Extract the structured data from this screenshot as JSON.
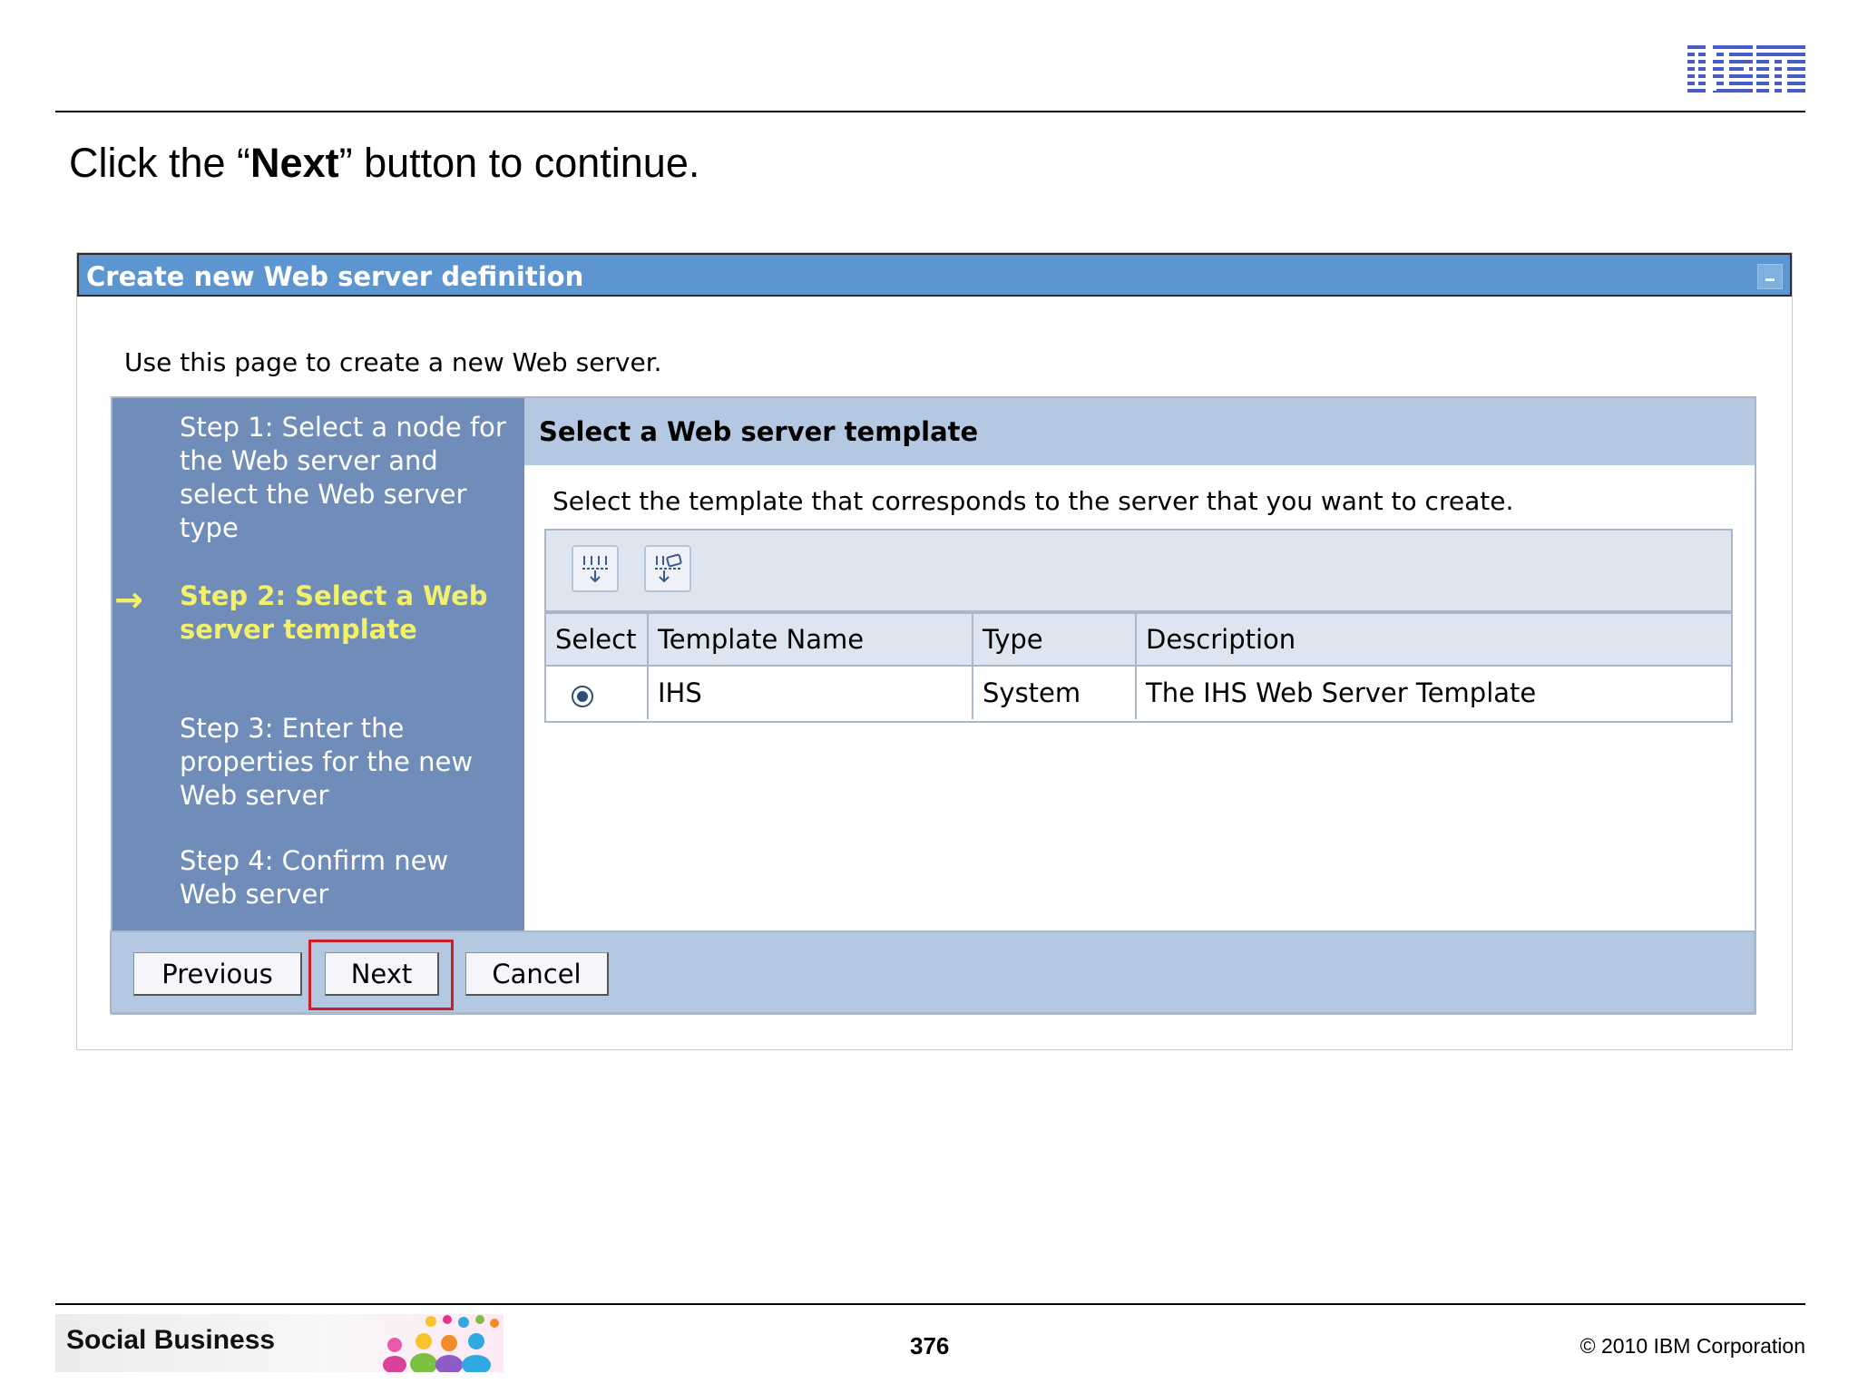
{
  "slide": {
    "logo_text": "IBM",
    "title_prefix": "Click the “",
    "title_emphasis": "Next",
    "title_suffix": "” button to continue.",
    "footer": {
      "brand": "Social Business",
      "page_number": "376",
      "copyright": "© 2010 IBM Corporation"
    }
  },
  "portlet": {
    "title": "Create new Web server definition",
    "intro": "Use this page to create a new Web server."
  },
  "wizard": {
    "current_step_index": 1,
    "steps": [
      "Step 1: Select a node for the Web server and select the Web server type",
      "Step 2: Select a Web server template",
      "Step 3: Enter the properties for the new Web server",
      "Step 4: Confirm new Web server"
    ],
    "section_title": "Select a Web server template",
    "section_description": "Select the template that corresponds to the server that you want to create.",
    "toolbar_icons": [
      "select-all-icon",
      "deselect-all-icon"
    ],
    "table": {
      "columns": [
        "Select",
        "Template Name",
        "Type",
        "Description"
      ],
      "rows": [
        {
          "selected": true,
          "template_name": "IHS",
          "type": "System",
          "description": "The IHS Web Server Template"
        }
      ]
    },
    "buttons": {
      "previous": "Previous",
      "next": "Next",
      "cancel": "Cancel"
    }
  },
  "colors": {
    "header_blue": "#5d95d0",
    "steps_panel": "#6f8db8",
    "current_step": "#f3f06a",
    "section_header": "#b5c8e2",
    "highlight": "#cc1f2a",
    "ibm_blue": "#4a5bc4"
  }
}
